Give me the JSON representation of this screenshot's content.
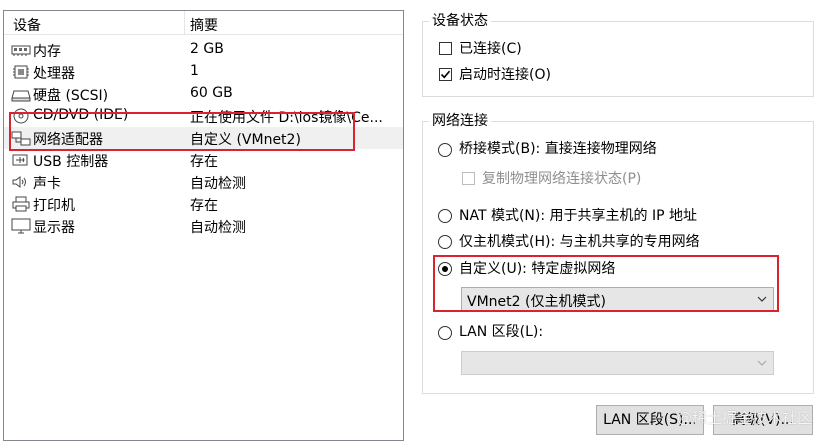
{
  "devices": {
    "header": {
      "device": "设备",
      "summary": "摘要"
    },
    "rows": [
      {
        "icon": "memory-icon",
        "name": "内存",
        "summary": "2 GB"
      },
      {
        "icon": "processor-icon",
        "name": "处理器",
        "summary": "1"
      },
      {
        "icon": "hard-disk-icon",
        "name": "硬盘 (SCSI)",
        "summary": "60 GB"
      },
      {
        "icon": "cd-dvd-icon",
        "name": "CD/DVD (IDE)",
        "summary": "正在使用文件 D:\\ios镜像\\Ce..."
      },
      {
        "icon": "network-adapter-icon",
        "name": "网络适配器",
        "summary": "自定义 (VMnet2)"
      },
      {
        "icon": "usb-icon",
        "name": "USB 控制器",
        "summary": "存在"
      },
      {
        "icon": "sound-card-icon",
        "name": "声卡",
        "summary": "自动检测"
      },
      {
        "icon": "printer-icon",
        "name": "打印机",
        "summary": "存在"
      },
      {
        "icon": "display-icon",
        "name": "显示器",
        "summary": "自动检测"
      }
    ],
    "selected_index": 4
  },
  "device_status": {
    "title": "设备状态",
    "connected": {
      "label": "已连接(C)",
      "checked": false
    },
    "connect_at_power_on": {
      "label": "启动时连接(O)",
      "checked": true
    }
  },
  "network_connection": {
    "title": "网络连接",
    "bridged": {
      "label": "桥接模式(B): 直接连接物理网络",
      "selected": false
    },
    "replicate": {
      "label": "复制物理网络连接状态(P)",
      "checked": false,
      "enabled": false
    },
    "nat": {
      "label": "NAT 模式(N): 用于共享主机的 IP 地址",
      "selected": false
    },
    "host_only": {
      "label": "仅主机模式(H): 与主机共享的专用网络",
      "selected": false
    },
    "custom": {
      "label": "自定义(U): 特定虚拟网络",
      "selected": true
    },
    "custom_network_value": "VMnet2 (仅主机模式)",
    "lan_segment": {
      "label": "LAN 区段(L):",
      "selected": false
    },
    "lan_segment_value": ""
  },
  "buttons": {
    "lan_segments": "LAN 区段(S)...",
    "advanced": "高级(V)..."
  },
  "watermark": "@稀土掘金技术社区",
  "colors": {
    "highlight_box": "#d9232e",
    "selected_row": "#f0f0f0"
  }
}
